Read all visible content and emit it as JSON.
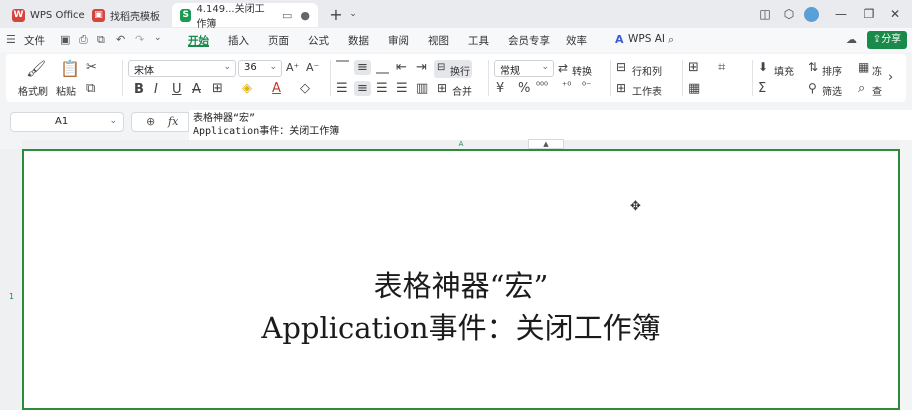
{
  "tabs": [
    {
      "label": "WPS Office",
      "color": "#d6453d"
    },
    {
      "label": "找稻壳模板",
      "color": "#d6453d"
    },
    {
      "label": "4.149...关闭工作簿",
      "color": "#1a9a52",
      "letter": "S"
    }
  ],
  "menu": {
    "file": "文件",
    "items": [
      "开始",
      "插入",
      "页面",
      "公式",
      "数据",
      "审阅",
      "视图",
      "工具",
      "会员专享",
      "效率"
    ],
    "wps_ai": "WPS AI",
    "share": "分享"
  },
  "ribbon": {
    "format_painter": "格式刷",
    "paste": "粘贴",
    "font_name": "宋体",
    "font_size": "36",
    "wrap": "换行",
    "merge": "合并",
    "number_format": "常规",
    "convert": "转换",
    "row_col": "行和列",
    "worksheet": "工作表",
    "fill": "填充",
    "sort": "排序",
    "filter": "筛选",
    "freeze": "冻",
    "find": "查"
  },
  "formula_bar": {
    "cell_ref": "A1",
    "fx": "fx",
    "line1": "表格神器“宏”",
    "line2": "Application事件：关闭工作簿"
  },
  "grid": {
    "column": "A",
    "row": "1",
    "cell_line1": "表格神器“宏”",
    "cell_line2": "Application事件：关闭工作簿"
  },
  "colors": {
    "accent": "#1a8a4a",
    "cell_border": "#2e8b3a"
  }
}
